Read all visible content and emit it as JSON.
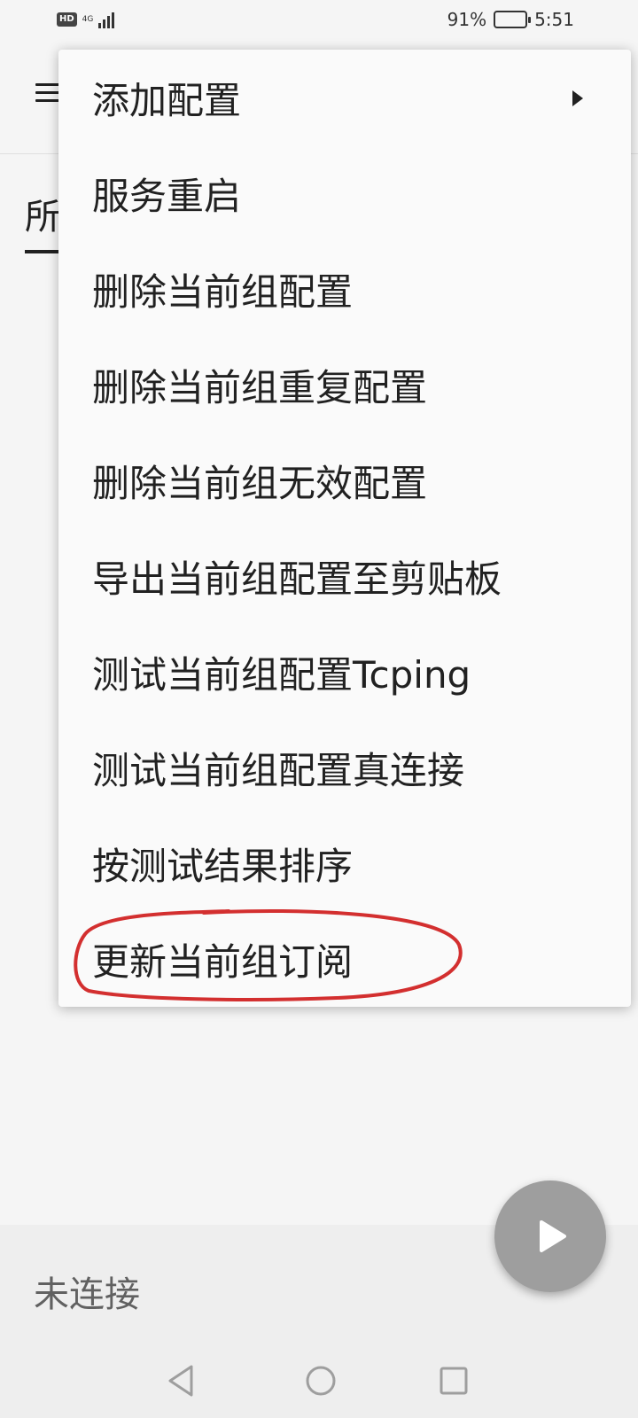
{
  "status_bar": {
    "hd_label": "HD",
    "network_type": "4G",
    "battery_percent": "91%",
    "battery_level": 0.91,
    "time": "5:51"
  },
  "tab": {
    "label": "所"
  },
  "menu": {
    "items": [
      {
        "label": "添加配置",
        "has_submenu": true
      },
      {
        "label": "服务重启"
      },
      {
        "label": "删除当前组配置"
      },
      {
        "label": "删除当前组重复配置"
      },
      {
        "label": "删除当前组无效配置"
      },
      {
        "label": "导出当前组配置至剪贴板"
      },
      {
        "label": "测试当前组配置Tcping"
      },
      {
        "label": "测试当前组配置真连接"
      },
      {
        "label": "按测试结果排序"
      },
      {
        "label": "更新当前组订阅",
        "annotated": true
      }
    ],
    "annotation_color": "#d32f2f"
  },
  "connection_status": "未连接",
  "fab_icon": "play-icon",
  "colors": {
    "fab": "#9e9e9e",
    "menu_background": "#fafafa",
    "page_background": "#f5f5f5"
  }
}
